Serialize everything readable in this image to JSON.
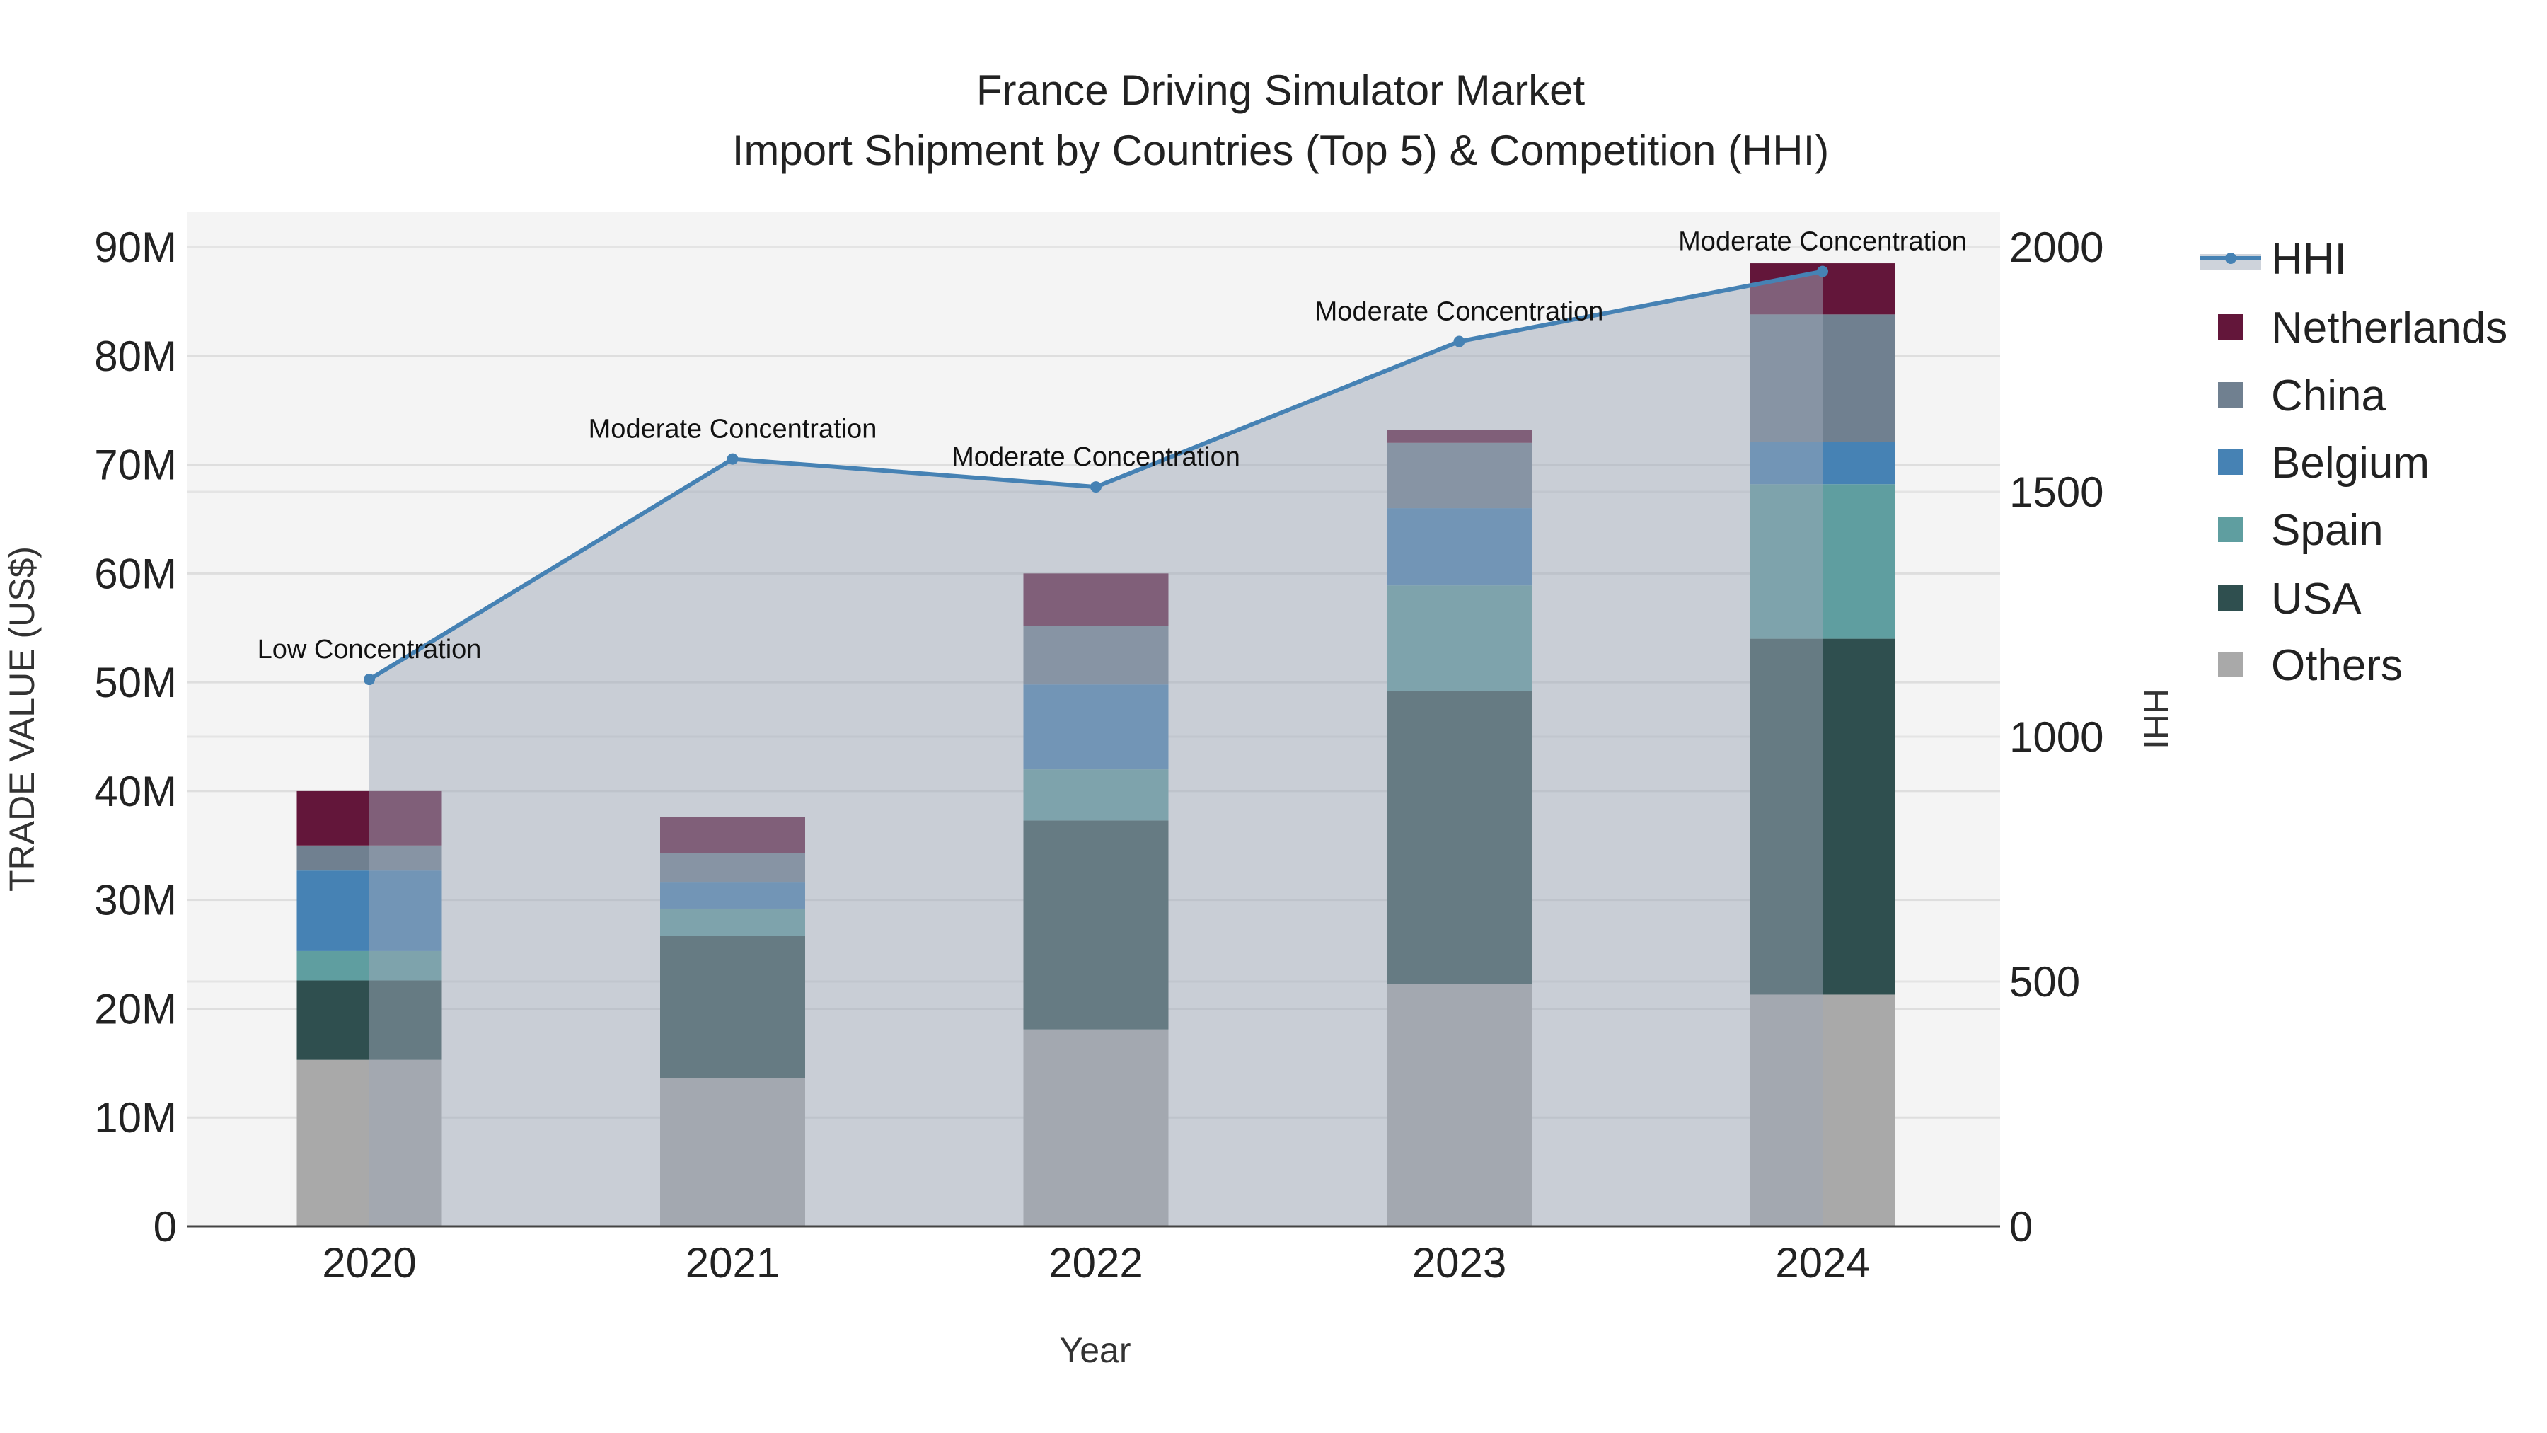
{
  "chart_data": {
    "type": "bar",
    "stacked": true,
    "title": "France Driving Simulator Market",
    "subtitle": "Import Shipment by Countries (Top 5) & Competition (HHI)",
    "xlabel": "Year",
    "ylabel": "TRADE VALUE (US$)",
    "y2label": "HHI",
    "categories": [
      "2020",
      "2021",
      "2022",
      "2023",
      "2024"
    ],
    "ylim": [
      0,
      93
    ],
    "y_unit": "M US$",
    "y_ticks": [
      0,
      10,
      20,
      30,
      40,
      50,
      60,
      70,
      80,
      90
    ],
    "y_tick_labels": [
      "0",
      "10M",
      "20M",
      "30M",
      "40M",
      "50M",
      "60M",
      "70M",
      "80M",
      "90M"
    ],
    "y2lim": [
      0,
      2067
    ],
    "y2_ticks": [
      0,
      500,
      1000,
      1500,
      2000
    ],
    "y2_tick_labels": [
      "0",
      "500",
      "1000",
      "1500",
      "2000"
    ],
    "grid": true,
    "legend_placement": "right",
    "series": [
      {
        "name": "Others",
        "color": "#a9a9a9",
        "values": [
          15.3,
          13.6,
          18.1,
          22.3,
          21.3
        ]
      },
      {
        "name": "USA",
        "color": "#2f4f4f",
        "values": [
          7.3,
          13.1,
          19.2,
          26.9,
          32.7
        ]
      },
      {
        "name": "Spain",
        "color": "#5f9ea0",
        "values": [
          2.7,
          2.5,
          4.7,
          9.7,
          14.2
        ]
      },
      {
        "name": "Belgium",
        "color": "#4682b4",
        "values": [
          7.4,
          2.4,
          7.8,
          7.1,
          3.9
        ]
      },
      {
        "name": "China",
        "color": "#708090",
        "values": [
          2.3,
          2.7,
          5.4,
          6.0,
          11.7
        ]
      },
      {
        "name": "Netherlands",
        "color": "#63163a",
        "values": [
          5.0,
          3.3,
          4.8,
          1.2,
          4.7
        ]
      }
    ],
    "hhi": {
      "name": "HHI",
      "color": "#4682b4",
      "values": [
        1117,
        1567,
        1510,
        1807,
        1950
      ],
      "annotations": [
        "Low Concentration",
        "Moderate Concentration",
        "Moderate Concentration",
        "Moderate Concentration",
        "Moderate Concentration"
      ]
    },
    "legend_order": [
      "HHI",
      "Netherlands",
      "China",
      "Belgium",
      "Spain",
      "USA",
      "Others"
    ]
  }
}
